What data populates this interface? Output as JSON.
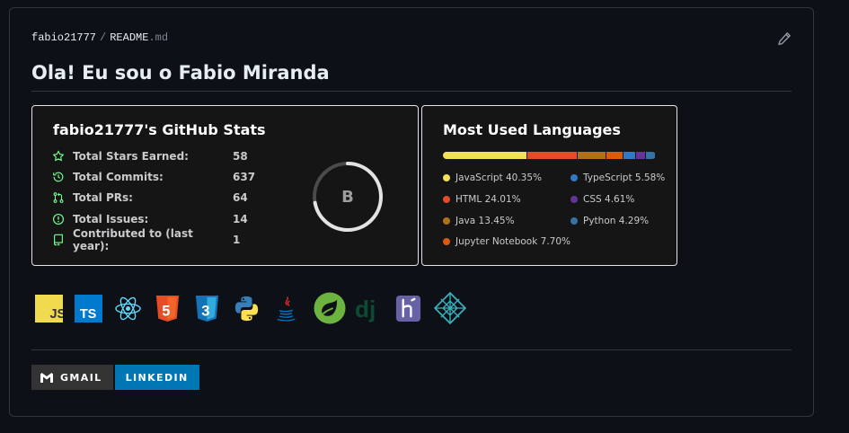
{
  "breadcrumb": {
    "owner": "fabio21777",
    "separator": "/",
    "file_name": "README",
    "file_ext": ".md"
  },
  "readme": {
    "heading": "Ola! Eu sou o Fabio Miranda"
  },
  "stats_card": {
    "title": "fabio21777's GitHub Stats",
    "rank": "B",
    "rank_progress": 0.72,
    "rows": [
      {
        "icon": "star-icon",
        "label": "Total Stars Earned:",
        "value": "58"
      },
      {
        "icon": "history-icon",
        "label": "Total Commits:",
        "value": "637"
      },
      {
        "icon": "pull-request-icon",
        "label": "Total PRs:",
        "value": "64"
      },
      {
        "icon": "issue-icon",
        "label": "Total Issues:",
        "value": "14"
      },
      {
        "icon": "repo-icon",
        "label": "Contributed to (last year):",
        "value": "1"
      }
    ],
    "colors": {
      "icon": "#79ff97",
      "ring": "#e4e2e2",
      "ring_track": "#4a4a4a"
    }
  },
  "languages_card": {
    "title": "Most Used Languages",
    "languages": [
      {
        "name": "JavaScript",
        "percent": "40.35%",
        "value": 40.35,
        "color": "#f1e05a"
      },
      {
        "name": "HTML",
        "percent": "24.01%",
        "value": 24.01,
        "color": "#e34c26"
      },
      {
        "name": "Java",
        "percent": "13.45%",
        "value": 13.45,
        "color": "#b07219"
      },
      {
        "name": "Jupyter Notebook",
        "percent": "7.70%",
        "value": 7.7,
        "color": "#da5b0b"
      },
      {
        "name": "TypeScript",
        "percent": "5.58%",
        "value": 5.58,
        "color": "#3178c6"
      },
      {
        "name": "CSS",
        "percent": "4.61%",
        "value": 4.61,
        "color": "#663399"
      },
      {
        "name": "Python",
        "percent": "4.29%",
        "value": 4.29,
        "color": "#3572a5"
      }
    ]
  },
  "tech_icons": [
    "javascript-icon",
    "typescript-icon",
    "react-icon",
    "html5-icon",
    "css3-icon",
    "python-icon",
    "java-icon",
    "spring-icon",
    "django-icon",
    "heroku-icon",
    "netlify-icon"
  ],
  "tech_labels": {
    "js": "JS",
    "ts": "TS",
    "html": "5",
    "css": "3",
    "django": "dj"
  },
  "badges": {
    "gmail": "GMAIL",
    "linkedin": "LINKEDIN"
  }
}
